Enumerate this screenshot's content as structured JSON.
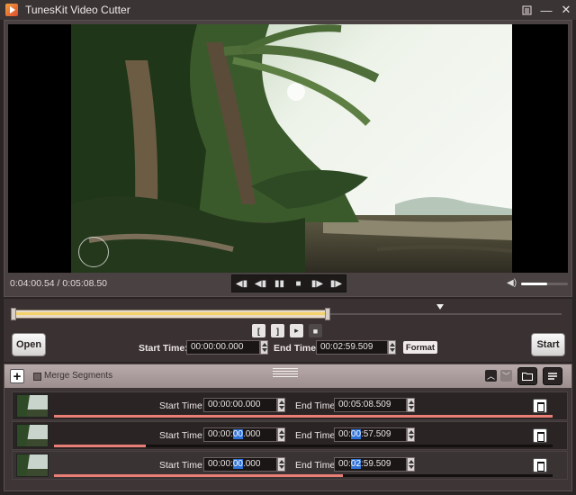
{
  "window": {
    "title": "TunesKit Video Cutter",
    "menu_icon": "menu-icon",
    "minimize_symbol": "—",
    "close_symbol": "✕"
  },
  "player": {
    "timecode": "0:04:00.54 / 0:05:08.50",
    "volume_level": 0.55,
    "playhead_position": 0.78,
    "controls": {
      "prev_frame": "◀▮",
      "step_back": "◀▮",
      "pause": "▮▮",
      "stop": "■",
      "step_forward": "▮▶",
      "next_frame": "▮▶"
    }
  },
  "editor": {
    "open_label": "Open",
    "start_label": "Start",
    "start_time_label": "Start Time:",
    "start_time_value": "00:00:00.000",
    "end_time_label": "End Time:",
    "end_time_value": "00:02:59.509",
    "format_label": "Format",
    "range_end_fraction": 0.58,
    "mark_in": "[",
    "mark_out": "]",
    "cursor_icon": "▸",
    "stop_icon": "■"
  },
  "segments_panel": {
    "add_symbol": "+",
    "merge_label": "Merge Segments",
    "merge_checked": false,
    "collapse_icon": "︿",
    "expand_icon": "﹀",
    "segments": [
      {
        "start_label": "Start Time:",
        "start_pre": "00:00:00.000",
        "start_hl": "",
        "start_post": "",
        "end_label": "End Time:",
        "end_pre": "00:05:08.509",
        "end_hl": "",
        "end_post": "",
        "progress": 1.0
      },
      {
        "start_label": "Start Time:",
        "start_pre": "00:00:",
        "start_hl": "00",
        "start_post": ".000",
        "end_label": "End Time:",
        "end_pre": "00:",
        "end_hl": "00",
        "end_post": ":57.509",
        "progress": 0.185
      },
      {
        "start_label": "Start Time:",
        "start_pre": "00:00:",
        "start_hl": "00",
        "start_post": ".000",
        "end_label": "End Time:",
        "end_pre": "00:",
        "end_hl": "02",
        "end_post": ":59.509",
        "progress": 0.58
      }
    ]
  },
  "colors": {
    "accent_highlight": "#2f72d8",
    "timeline_fill": "#f4d26a",
    "segment_bar": "#e87e76",
    "panel_bg": "#2a2424"
  }
}
